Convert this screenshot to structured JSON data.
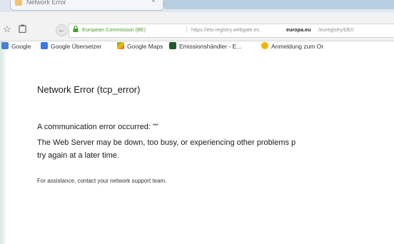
{
  "browser": {
    "tab": {
      "title": "Network Error",
      "close_glyph": "×"
    },
    "toolbar": {
      "star_icon": "star-icon",
      "back_glyph": "←",
      "address": {
        "cert_label": "European Commission (BE)",
        "url_prefix": "https://ets-registry.webgate.ec.",
        "url_host": "europa.eu",
        "url_suffix": "/euregistry/DE/i"
      }
    },
    "bookmarks": [
      {
        "label": "Google",
        "color": "#4a7fd6"
      },
      {
        "label": "Google Übersetzer",
        "color": "#3b78e7"
      },
      {
        "label": "Google Maps",
        "color": "#34a853"
      },
      {
        "label": "Emissionshändler - E...",
        "color": "#1f5d2b"
      },
      {
        "label": "Anmeldung zum Or",
        "color": "#f2b400"
      }
    ]
  },
  "page": {
    "title": "Network Error (tcp_error)",
    "line1": "A communication error occurred: \"\"",
    "line2": "The Web Server may be down, too busy, or experiencing other problems p",
    "line3": "try again at a later time.",
    "note": "For assistance, contact your network support team."
  }
}
